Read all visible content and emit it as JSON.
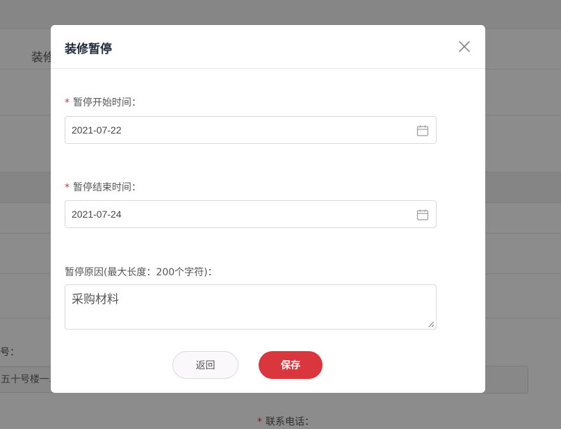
{
  "background": {
    "tab_label": "装修",
    "field_left_label": "号：",
    "field_left_value": "五十号楼一单",
    "phone_label": "联系电话："
  },
  "modal": {
    "title": "装修暂停",
    "start": {
      "required_mark": "*",
      "label": "暂停开始时间：",
      "value": "2021-07-22"
    },
    "end": {
      "required_mark": "*",
      "label": "暂停结束时间：",
      "value": "2021-07-24"
    },
    "reason": {
      "label": "暂停原因(最大长度：200个字符)：",
      "value": "采购材料"
    },
    "buttons": {
      "back": "返回",
      "save": "保存"
    }
  },
  "colors": {
    "primary": "#d9363e",
    "overlay": "rgba(0,0,0,0.45)"
  },
  "icons": {
    "close": "close-icon",
    "calendar": "calendar-icon"
  }
}
